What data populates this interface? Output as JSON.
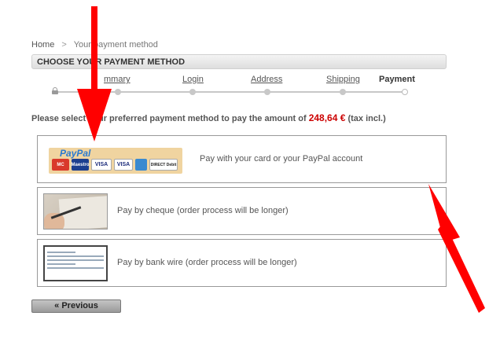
{
  "breadcrumb": {
    "home": "Home",
    "separator": ">",
    "current": "Your payment method"
  },
  "page_title": "CHOOSE YOUR PAYMENT METHOD",
  "steps": [
    {
      "label": "Summary",
      "visible": "mmary"
    },
    {
      "label": "Login"
    },
    {
      "label": "Address"
    },
    {
      "label": "Shipping"
    },
    {
      "label": "Payment"
    }
  ],
  "instruction": {
    "before": "Please select your preferred payment method to pay the amount of ",
    "amount": "248,64 €",
    "after": " (tax incl.)"
  },
  "payment_options": [
    {
      "text": "Pay with your card or your PayPal account",
      "logo": "paypal-logo"
    },
    {
      "text": "Pay by cheque (order process will be longer)",
      "logo": "cheque-image"
    },
    {
      "text": "Pay by bank wire (order process will be longer)",
      "logo": "bank-wire-image"
    }
  ],
  "paypal_logo": {
    "wordmark_a": "Pay",
    "wordmark_b": "Pal",
    "cards": [
      "MC",
      "Maestro",
      "VISA",
      "VISA",
      "AMEX",
      "DIRECT Debit"
    ]
  },
  "prev_button": "« Previous",
  "colors": {
    "amount": "#cc0000",
    "arrow": "#ff0000",
    "title_bar": "#e6e6e6"
  }
}
